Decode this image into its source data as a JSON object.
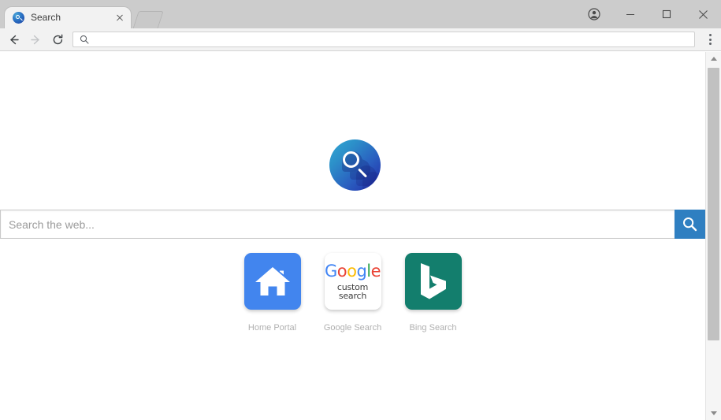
{
  "window": {
    "titlebar": {
      "tab": {
        "title": "Search",
        "favicon_name": "search-globe-favicon",
        "close_label": "×"
      },
      "new_tab_label": "",
      "controls": {
        "profile_label": "",
        "minimize_label": "",
        "maximize_label": "",
        "close_label": ""
      }
    },
    "toolbar": {
      "back_label": "",
      "forward_label": "",
      "reload_label": "",
      "omnibox": {
        "value": "",
        "placeholder": "",
        "icon_name": "search-icon"
      },
      "menu_label": ""
    }
  },
  "page": {
    "logo": {
      "name": "search-logo",
      "gradient_from": "#31a9d4",
      "gradient_to": "#2229a8"
    },
    "search": {
      "placeholder": "Search the web...",
      "value": "",
      "button_label": "",
      "button_color": "#2f7fc1"
    },
    "tiles": [
      {
        "id": "home-portal",
        "label": "Home Portal",
        "icon_name": "house-icon",
        "background": "#4285ee"
      },
      {
        "id": "google-search",
        "label": "Google Search",
        "icon_name": "google-custom-search-logo",
        "background": "#ffffff",
        "logo_letters": [
          "G",
          "o",
          "o",
          "g",
          "l",
          "e"
        ],
        "logo_subtitle": "custom search",
        "logo_colors": [
          "#4285f4",
          "#ea4335",
          "#fbbc05",
          "#4285f4",
          "#34a853",
          "#ea4335"
        ]
      },
      {
        "id": "bing-search",
        "label": "Bing Search",
        "icon_name": "bing-logo",
        "background": "#137e6d"
      }
    ]
  },
  "scrollbar": {
    "up_label": "",
    "down_label": "",
    "thumb_label": ""
  }
}
